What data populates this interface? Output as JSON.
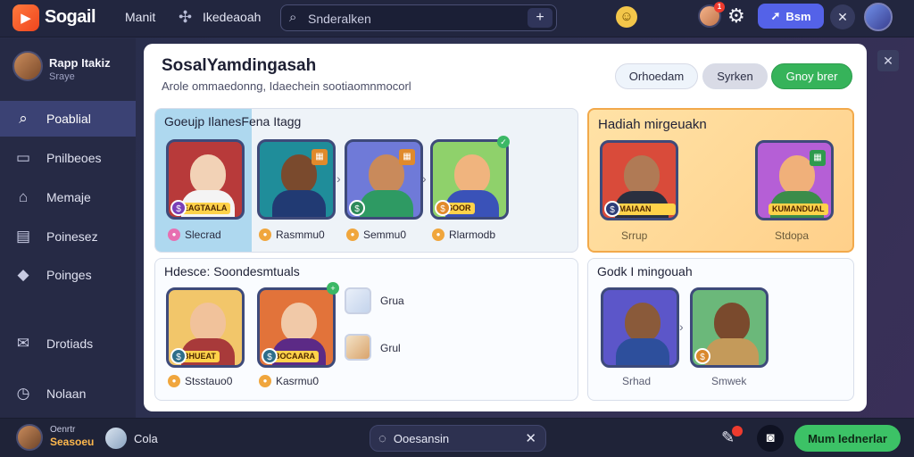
{
  "topbar": {
    "brand": "Sogail",
    "nav1": "Manit",
    "nav2": "Ikedeaoah",
    "search_placeholder": "Snderalken",
    "join_label": "Bsm",
    "notification_count": "1"
  },
  "sidebar": {
    "profile_name": "Rapp Itakiz",
    "profile_sub": "Sraye",
    "items": [
      {
        "label": "Poablial",
        "icon": "search-icon"
      },
      {
        "label": "Pnilbeoes",
        "icon": "inbox-icon"
      },
      {
        "label": "Memaje",
        "icon": "home-icon"
      },
      {
        "label": "Poinesez",
        "icon": "list-icon"
      },
      {
        "label": "Poinges",
        "icon": "tag-icon"
      },
      {
        "label": "Drotiads",
        "icon": "mail-icon"
      },
      {
        "label": "Nolaan",
        "icon": "clock-icon"
      }
    ]
  },
  "panel": {
    "title": "SosalYamdingasah",
    "subtitle": "Arole ommaedonng, Idaechein sootiaomnmocorl",
    "pills": [
      "Orhoedam",
      "Syrken",
      "Gnoy brer"
    ]
  },
  "cards": {
    "card1": {
      "title": "Goeujp IlanesFena Itagg",
      "tiles": [
        {
          "caption": "EAGTAALA"
        },
        {
          "caption": ""
        },
        {
          "caption": ""
        },
        {
          "caption": "SOOR"
        }
      ],
      "labels": [
        "Slecrad",
        "Rasmmu0",
        "Semmu0",
        "Rlarmodb"
      ]
    },
    "card2": {
      "title": "Hadiah mirgeuakn",
      "tiles": [
        {
          "caption": "IMAIAAN IANIA"
        },
        {
          "caption": "KUMANDUAL"
        }
      ],
      "labels": [
        "Srrup",
        "Stdopa"
      ]
    },
    "card3": {
      "title": "Hdesce: Soondesmtuals",
      "tiles": [
        {
          "caption": "BHUEAT"
        },
        {
          "caption": "BOCAARA"
        }
      ],
      "labels": [
        "Stsstauo0",
        "Kasrmu0"
      ],
      "list": [
        "Grua",
        "Grul"
      ]
    },
    "card4": {
      "title": "Godk I mingouah",
      "labels": [
        "Srhad",
        "Smwek"
      ]
    }
  },
  "bottombar": {
    "name1": "Oenrtr",
    "name2": "Seasoeu",
    "friend": "Cola",
    "chat_label": "Ooesansin",
    "cta": "Mum Iednerlar"
  }
}
